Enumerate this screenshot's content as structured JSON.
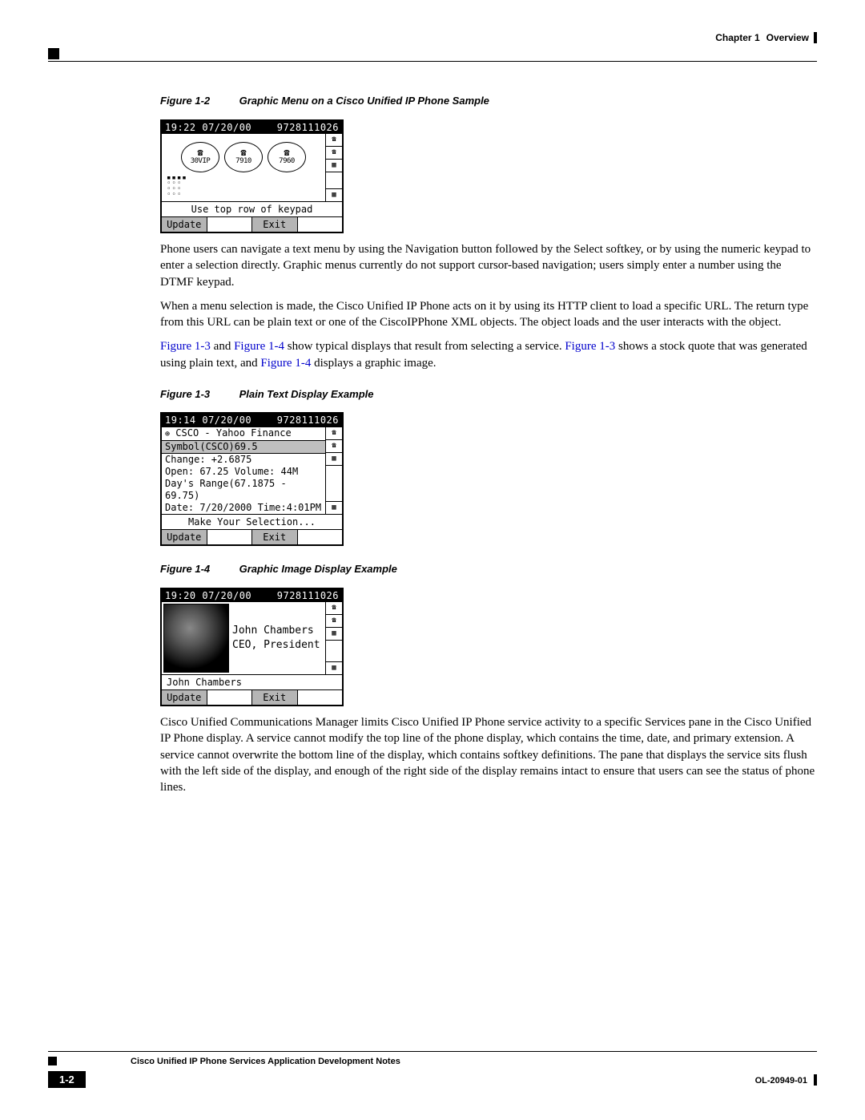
{
  "header": {
    "chapter": "Chapter 1",
    "title": "Overview"
  },
  "figure2": {
    "label": "Figure 1-2",
    "caption": "Graphic Menu on a Cisco Unified IP Phone Sample",
    "time": "19:22 07/20/00",
    "ext": "9728111026",
    "icons": [
      "30VIP",
      "7910",
      "7960"
    ],
    "prompt": "Use top row of keypad",
    "sk1": "Update",
    "sk2": "Exit"
  },
  "para1": "Phone users can navigate a text menu by using the Navigation button followed by the Select softkey, or by using the numeric keypad to enter a selection directly. Graphic menus currently do not support cursor-based navigation; users simply enter a number using the DTMF keypad.",
  "para2": "When a menu selection is made, the Cisco Unified IP Phone acts on it by using its HTTP client to load a specific URL. The return type from this URL can be plain text or one of the CiscoIPPhone XML objects. The object loads and the user interacts with the object.",
  "links": {
    "fig13a": "Figure 1-3",
    "and": " and ",
    "fig14a": "Figure 1-4",
    "mid": " show typical displays that result from selecting a service. ",
    "fig13b": "Figure 1-3",
    "mid2": " shows a stock quote that was generated using plain text, and ",
    "fig14b": "Figure 1-4",
    "end": " displays a graphic image."
  },
  "figure3": {
    "label": "Figure 1-3",
    "caption": "Plain Text Display Example",
    "time": "19:14 07/20/00",
    "ext": "9728111026",
    "title": "CSCO - Yahoo Finance",
    "l1": "Symbol(CSCO)69.5",
    "l2": "Change: +2.6875",
    "l3": "Open: 67.25 Volume: 44M",
    "l4": "Day's Range(67.1875 - 69.75)",
    "l5": "Date: 7/20/2000 Time:4:01PM",
    "prompt": "Make Your Selection...",
    "sk1": "Update",
    "sk2": "Exit"
  },
  "figure4": {
    "label": "Figure 1-4",
    "caption": "Graphic Image Display Example",
    "time": "19:20 07/20/00",
    "ext": "9728111026",
    "name": "John Chambers",
    "role": "CEO, President",
    "prompt": "John Chambers",
    "sk1": "Update",
    "sk2": "Exit"
  },
  "para3": "Cisco Unified Communications Manager limits Cisco Unified IP Phone service activity to a specific Services pane in the Cisco Unified IP Phone display. A service cannot modify the top line of the phone display, which contains the time, date, and primary extension. A service cannot overwrite the bottom line of the display, which contains softkey definitions. The pane that displays the service sits flush with the left side of the display, and enough of the right side of the display remains intact to ensure that users can see the status of phone lines.",
  "footer": {
    "title": "Cisco Unified IP Phone Services Application Development Notes",
    "page": "1-2",
    "docid": "OL-20949-01"
  }
}
